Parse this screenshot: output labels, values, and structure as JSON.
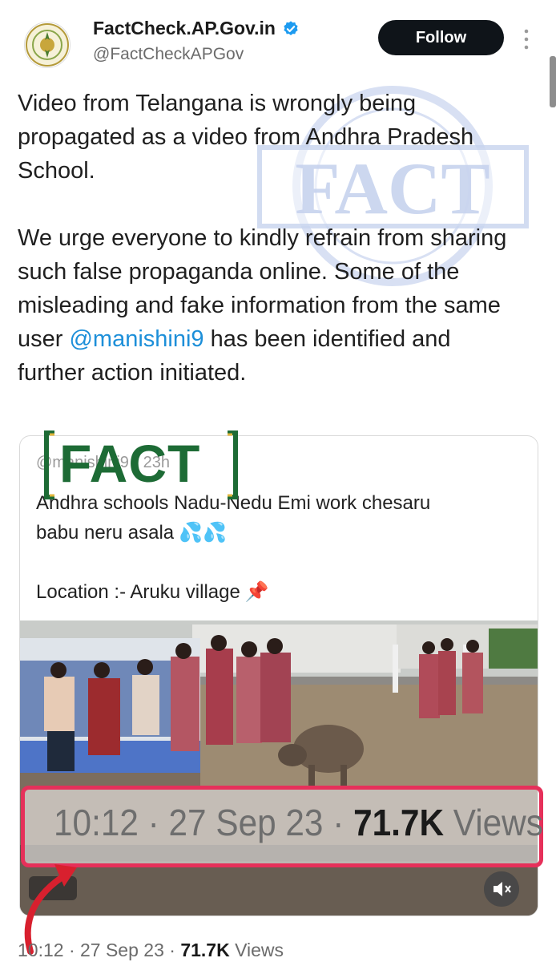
{
  "account": {
    "name": "FactCheck.AP.Gov.in",
    "handle": "@FactCheckAPGov",
    "follow_label": "Follow",
    "avatar_icon": "andhra-pradesh-emblem-icon",
    "verified_icon": "verified-badge-icon"
  },
  "tweet": {
    "para1": "Video from Telangana is wrongly being propagated as a video from Andhra Pradesh School.",
    "para2_before": "We urge everyone to kindly refrain from sharing such false propaganda online. Some of the misleading and fake information from the same user ",
    "mention": "@manishini9",
    "para2_after": " has been identified and further action initiated."
  },
  "quoted": {
    "header": "@manishini9 · 23h",
    "text_line1": "Andhra schools Nadu-Nedu Emi work chesaru",
    "text_line2": "babu neru asala",
    "text_line2_emoji": "💦💦",
    "location": "Location :- Aruku village",
    "location_emoji": "📌"
  },
  "overlay": {
    "fact_stamp": "FACT",
    "watermark_word": "FACT",
    "highlight_time": "10:12 · 27 Sep 23 · ",
    "highlight_views_count": "71.7K",
    "highlight_views_label": " Views"
  },
  "meta": {
    "time": "10:12 · 27 Sep 23 · ",
    "views_count": "71.7K",
    "views_label": " Views"
  },
  "colors": {
    "follow_bg": "#0f1419",
    "mention": "#1d8fd9",
    "highlight_border": "#e6305a",
    "fact_green": "#1d6b35",
    "watermark_blue": "#c7d3ee"
  }
}
